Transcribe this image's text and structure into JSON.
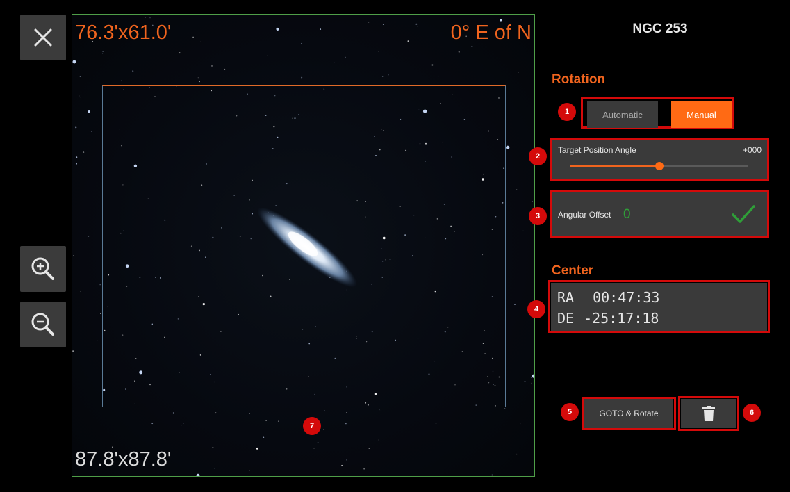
{
  "viewer": {
    "fov_top": "76.3'x61.0'",
    "angle": "0° E of N",
    "fov_bottom": "87.8'x87.8'"
  },
  "object_name": "NGC 253",
  "rotation": {
    "title": "Rotation",
    "mode_auto": "Automatic",
    "mode_manual": "Manual",
    "selected": "Manual",
    "target_label": "Target Position Angle",
    "target_value": "+000",
    "slider_fraction": 0.5,
    "offset_label": "Angular Offset",
    "offset_value": "0"
  },
  "center": {
    "title": "Center",
    "ra_label": "RA",
    "ra_value": "00:47:33",
    "de_label": "DE",
    "de_value": "-25:17:18"
  },
  "actions": {
    "goto_label": "GOTO & Rotate"
  },
  "markers": [
    "1",
    "2",
    "3",
    "4",
    "5",
    "6",
    "7"
  ],
  "colors": {
    "accent": "#f0641e",
    "success": "#2f9e38",
    "highlight": "#d40a0a",
    "fov_frame": "#4f9e48"
  },
  "icons": {
    "close": "close-icon",
    "zoom_in": "zoom-in-icon",
    "zoom_out": "zoom-out-icon",
    "delete": "trash-icon",
    "confirm": "check-icon"
  }
}
